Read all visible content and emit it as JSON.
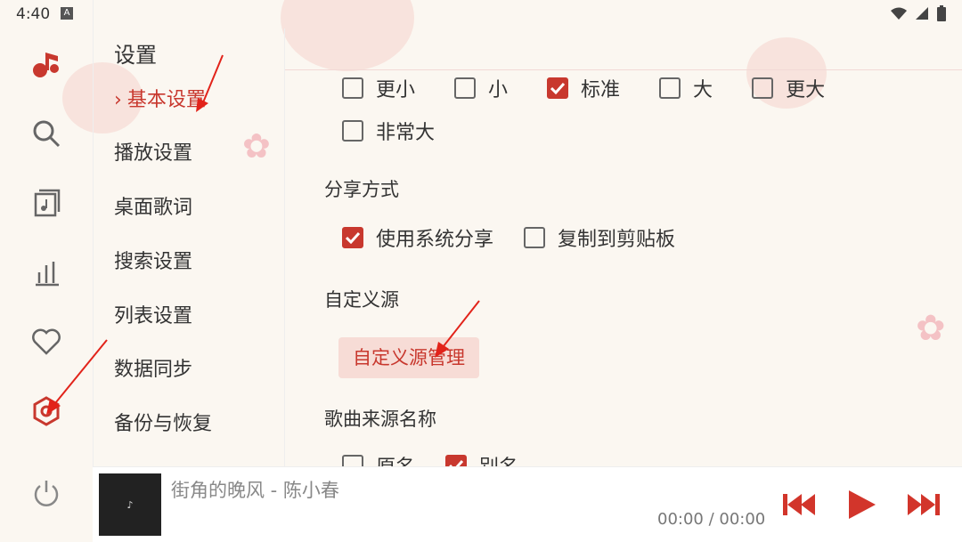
{
  "status": {
    "time": "4:40",
    "a_badge": "A"
  },
  "rail": {
    "items": [
      "music-logo-icon",
      "search-icon",
      "music-list-icon",
      "chart-icon",
      "heart-icon",
      "settings-icon",
      "power-icon"
    ]
  },
  "menu": {
    "title": "设置",
    "items": [
      {
        "label": "基本设置",
        "active": true
      },
      {
        "label": "播放设置"
      },
      {
        "label": "桌面歌词"
      },
      {
        "label": "搜索设置"
      },
      {
        "label": "列表设置"
      },
      {
        "label": "数据同步"
      },
      {
        "label": "备份与恢复"
      }
    ]
  },
  "font_size": {
    "options": [
      {
        "label": "更小",
        "checked": false
      },
      {
        "label": "小",
        "checked": false
      },
      {
        "label": "标准",
        "checked": true
      },
      {
        "label": "大",
        "checked": false
      },
      {
        "label": "更大",
        "checked": false
      },
      {
        "label": "非常大",
        "checked": false
      }
    ]
  },
  "share": {
    "title": "分享方式",
    "options": [
      {
        "label": "使用系统分享",
        "checked": true
      },
      {
        "label": "复制到剪贴板",
        "checked": false
      }
    ]
  },
  "custom_source": {
    "title": "自定义源",
    "button": "自定义源管理"
  },
  "source_name": {
    "title": "歌曲来源名称",
    "options": [
      {
        "label": "原名",
        "checked": false
      },
      {
        "label": "别名",
        "checked": true
      }
    ]
  },
  "player": {
    "title": "街角的晚风 - 陈小春",
    "time": "00:00 / 00:00"
  },
  "colors": {
    "accent": "#c8382e",
    "background": "#fbf7f1"
  }
}
